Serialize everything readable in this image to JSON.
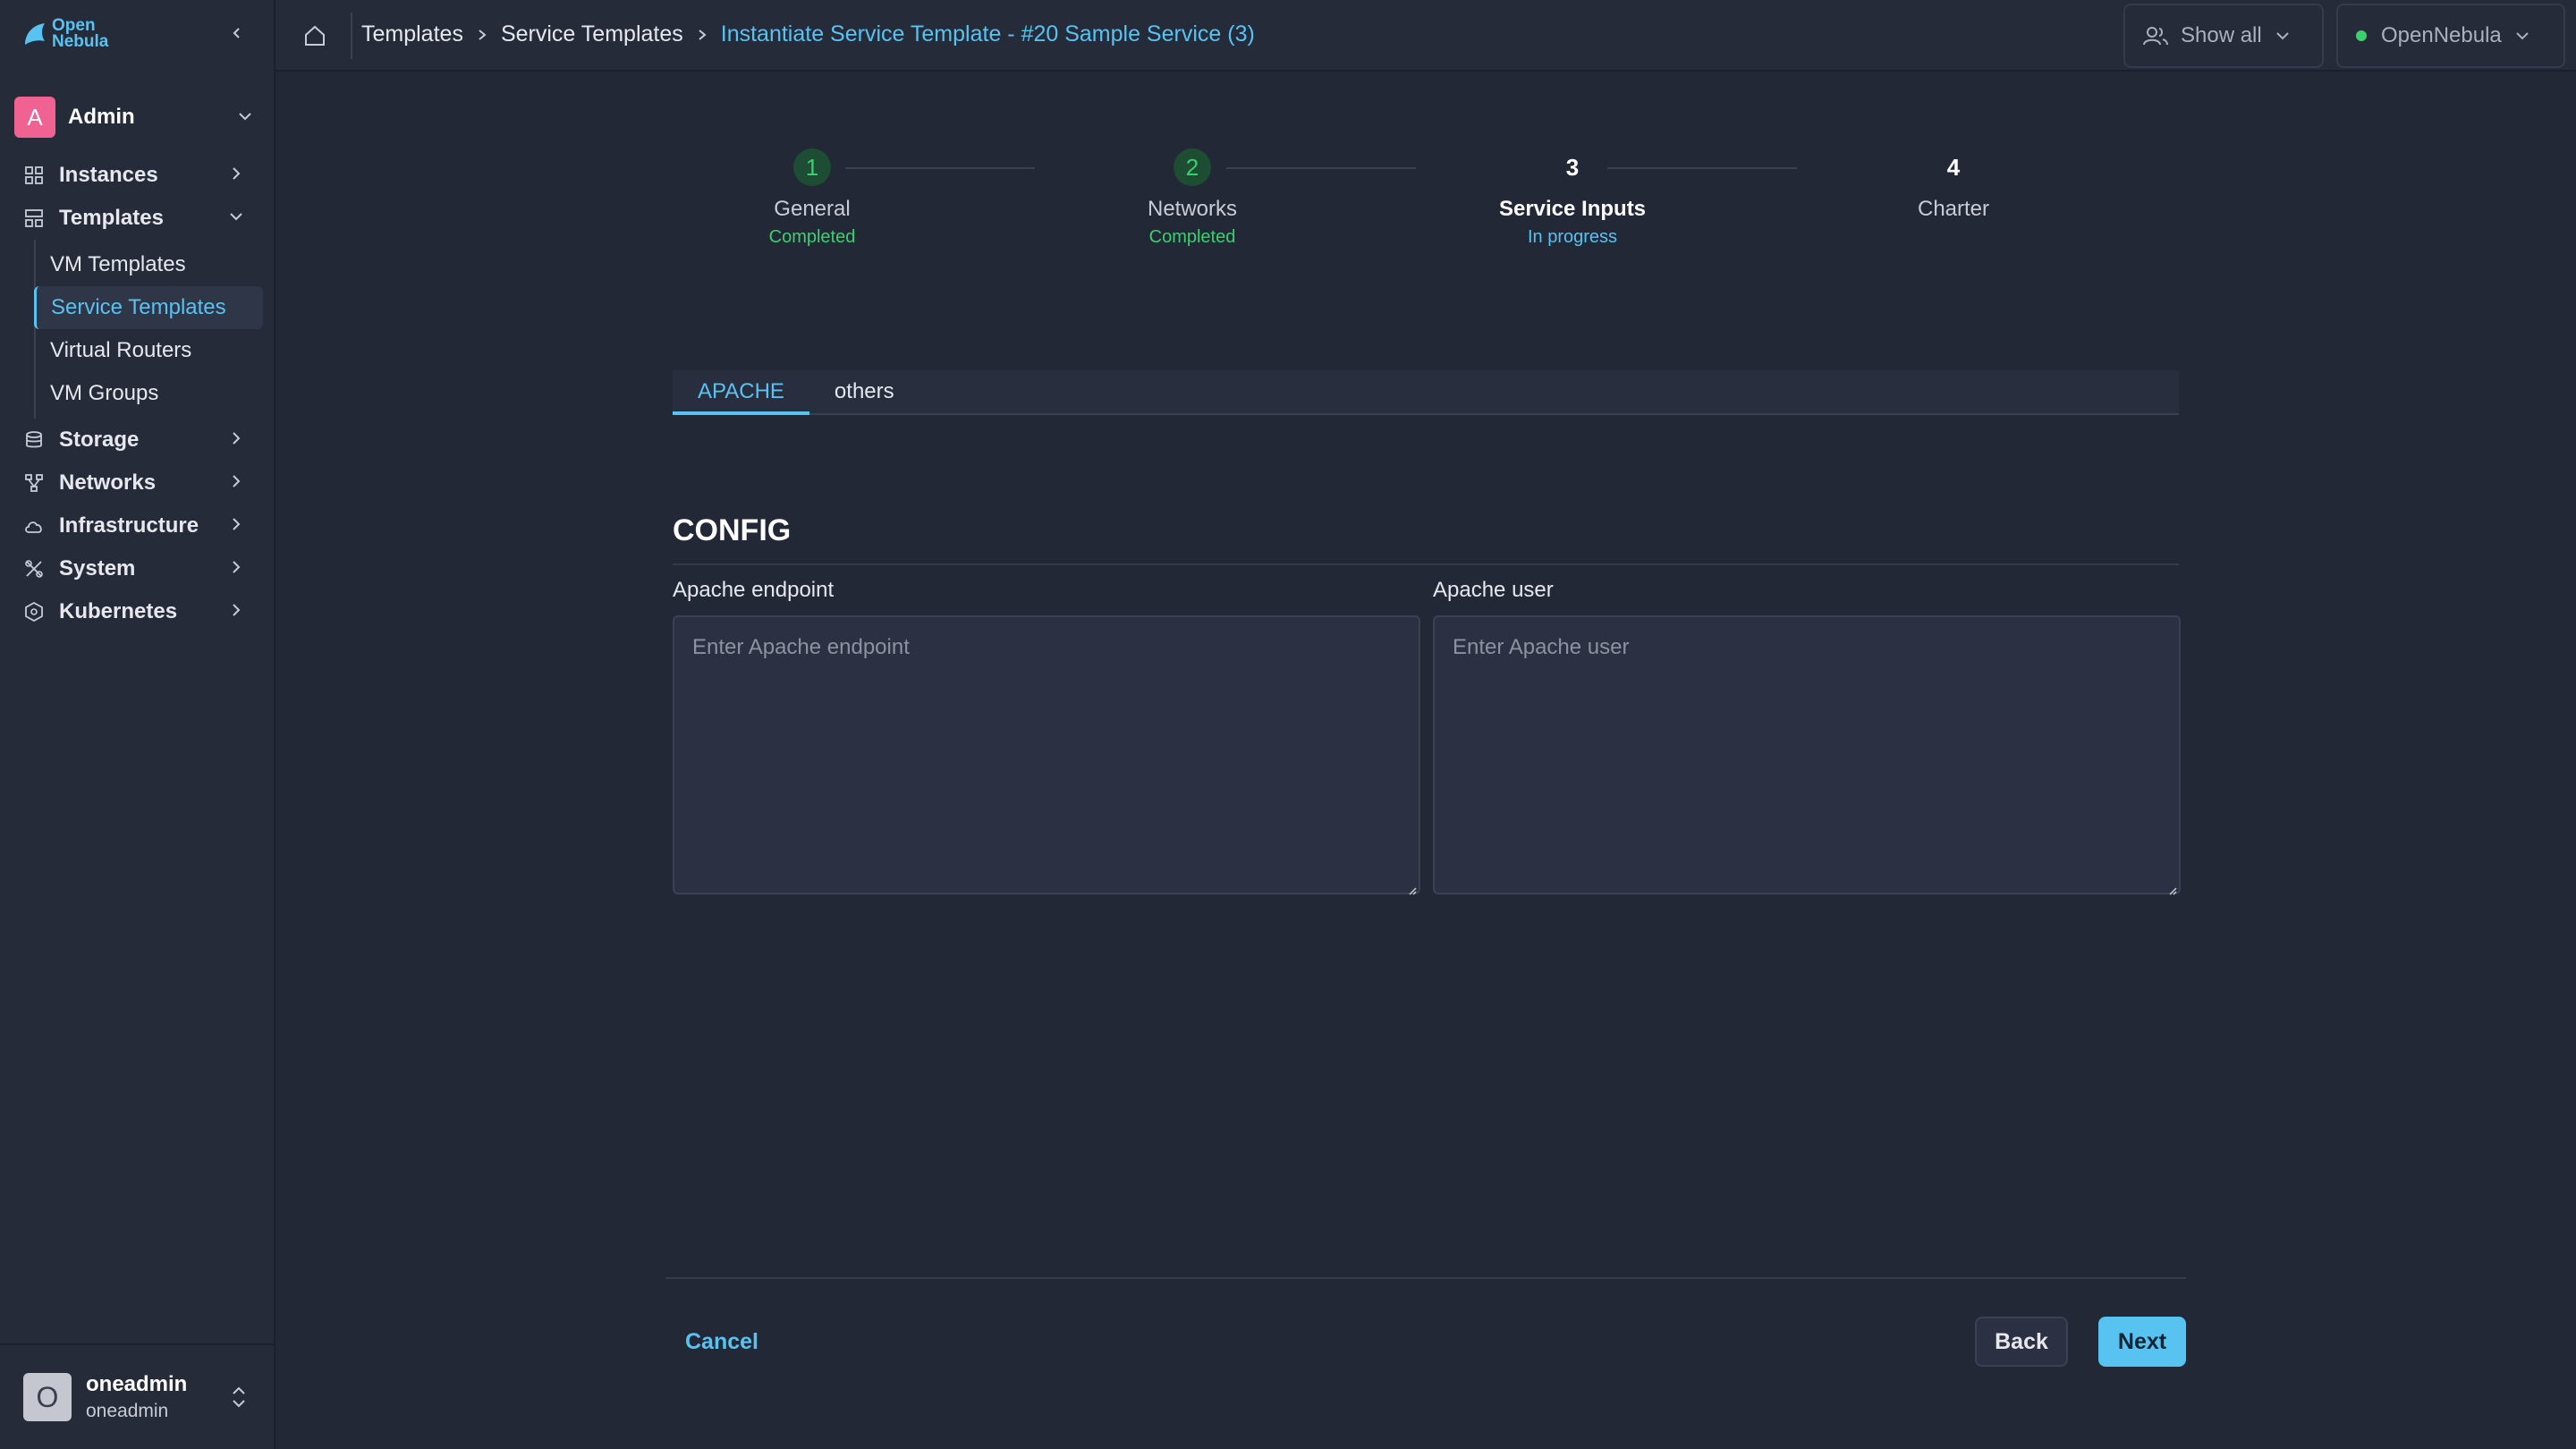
{
  "app": {
    "logo_line1": "Open",
    "logo_line2": "Nebula"
  },
  "sidebar": {
    "group": {
      "initial": "A",
      "name": "Admin"
    },
    "items": [
      {
        "label": "Instances",
        "icon": "instances-icon"
      },
      {
        "label": "Templates",
        "icon": "templates-icon",
        "expanded": true
      },
      {
        "label": "Storage",
        "icon": "storage-icon"
      },
      {
        "label": "Networks",
        "icon": "networks-icon"
      },
      {
        "label": "Infrastructure",
        "icon": "cloud-icon"
      },
      {
        "label": "System",
        "icon": "system-icon"
      },
      {
        "label": "Kubernetes",
        "icon": "kubernetes-icon"
      }
    ],
    "templates_sub": [
      {
        "label": "VM Templates"
      },
      {
        "label": "Service Templates",
        "active": true
      },
      {
        "label": "Virtual Routers"
      },
      {
        "label": "VM Groups"
      }
    ],
    "user": {
      "initial": "O",
      "name": "oneadmin",
      "group": "oneadmin"
    }
  },
  "topbar": {
    "breadcrumb": [
      "Templates",
      "Service Templates",
      "Instantiate Service Template - #20 Sample Service (3)"
    ],
    "show_all": "Show all",
    "zone": "OpenNebula"
  },
  "stepper": {
    "steps": [
      {
        "number": "1",
        "label": "General",
        "status": "Completed",
        "state": "done"
      },
      {
        "number": "2",
        "label": "Networks",
        "status": "Completed",
        "state": "done"
      },
      {
        "number": "3",
        "label": "Service Inputs",
        "status": "In progress",
        "state": "active"
      },
      {
        "number": "4",
        "label": "Charter",
        "status": "",
        "state": "todo"
      }
    ]
  },
  "tabs": [
    {
      "label": "APACHE",
      "active": true
    },
    {
      "label": "others",
      "active": false
    }
  ],
  "section": {
    "title": "CONFIG",
    "fields": [
      {
        "label": "Apache endpoint",
        "placeholder": "Enter Apache endpoint",
        "value": ""
      },
      {
        "label": "Apache user",
        "placeholder": "Enter Apache user",
        "value": ""
      }
    ]
  },
  "actions": {
    "cancel": "Cancel",
    "back": "Back",
    "next": "Next"
  },
  "colors": {
    "accent": "#58c2f0",
    "success": "#3ccf6e",
    "background": "#232837",
    "sidebar": "#262b3a"
  }
}
